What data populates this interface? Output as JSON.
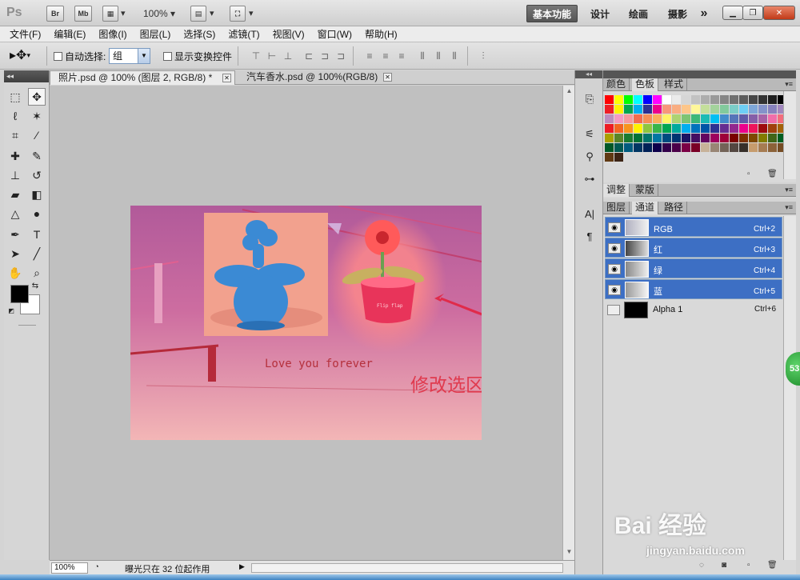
{
  "titlebar": {
    "app_logo": "Ps",
    "bridge": "Br",
    "minibridge": "Mb",
    "zoom": "100%",
    "workspaces": [
      "基本功能",
      "设计",
      "绘画",
      "摄影"
    ],
    "more": "»"
  },
  "menu": [
    "文件(F)",
    "编辑(E)",
    "图像(I)",
    "图层(L)",
    "选择(S)",
    "滤镜(T)",
    "视图(V)",
    "窗口(W)",
    "帮助(H)"
  ],
  "options": {
    "auto_select_label": "自动选择:",
    "auto_select_value": "组",
    "show_transform_label": "显示变换控件"
  },
  "doc_tabs": [
    {
      "label": "照片.psd @ 100% (图层 2, RGB/8) *",
      "active": true
    },
    {
      "label": "汽车香水.psd @ 100%(RGB/8)",
      "active": false
    }
  ],
  "canvas": {
    "caption": "Love you forever",
    "annotation": "修改选区",
    "pot_text": "Flip flap"
  },
  "status": {
    "zoom": "100%",
    "message": "曝光只在 32 位起作用"
  },
  "swatch_panel": {
    "tabs": [
      "颜色",
      "色板",
      "样式"
    ],
    "active": 1,
    "colors": [
      "#ff0000",
      "#ffff00",
      "#00ff00",
      "#00ffff",
      "#0000ff",
      "#ff00ff",
      "#ffffff",
      "#ebebeb",
      "#d6d6d6",
      "#c2c2c2",
      "#adadad",
      "#999999",
      "#858585",
      "#707070",
      "#5c5c5c",
      "#474747",
      "#333333",
      "#1f1f1f",
      "#000000",
      "#ee1d24",
      "#fef200",
      "#00a650",
      "#00aeef",
      "#2e3092",
      "#ec008c",
      "#f7977a",
      "#f9ad81",
      "#fdc68a",
      "#fff79a",
      "#c4df9b",
      "#a3d39c",
      "#82ca9d",
      "#7bcdc8",
      "#6ecff6",
      "#7ea7d8",
      "#8493ca",
      "#8882be",
      "#a187be",
      "#bc8dbf",
      "#f49ac2",
      "#f6989d",
      "#f26c4f",
      "#f68e55",
      "#fbaf5c",
      "#fff467",
      "#acd372",
      "#7dc473",
      "#3cb878",
      "#1cbbb4",
      "#00bff3",
      "#438ccb",
      "#5574b9",
      "#605ca8",
      "#855fa8",
      "#a763a8",
      "#f06eaa",
      "#f26d7d",
      "#ed1c24",
      "#f26522",
      "#f7941d",
      "#fff200",
      "#8dc63f",
      "#39b54a",
      "#00a651",
      "#00a99d",
      "#00aeef",
      "#0072bc",
      "#0054a6",
      "#2e3192",
      "#662d91",
      "#92278f",
      "#ec008c",
      "#ed145b",
      "#9e0b0f",
      "#a0410d",
      "#a36209",
      "#aba000",
      "#598527",
      "#197b30",
      "#007236",
      "#00746b",
      "#0076a3",
      "#004b80",
      "#003471",
      "#1b1464",
      "#440e62",
      "#630460",
      "#9e005d",
      "#9e0039",
      "#790000",
      "#7b2e00",
      "#7d4900",
      "#827b00",
      "#406618",
      "#005e20",
      "#005826",
      "#005952",
      "#005b7f",
      "#003663",
      "#002157",
      "#0d004c",
      "#32004b",
      "#4b0049",
      "#7b0046",
      "#7a0026",
      "#c7b299",
      "#998675",
      "#736357",
      "#534741",
      "#372f2a",
      "#c69c6d",
      "#a67c52",
      "#8c6239",
      "#754c24",
      "#603913",
      "#3c2415"
    ]
  },
  "adjust_panel": {
    "tabs": [
      "调整",
      "蒙版"
    ],
    "active": 0
  },
  "channels_panel": {
    "tabs": [
      "图层",
      "通道",
      "路径"
    ],
    "active": 1,
    "rows": [
      {
        "name": "RGB",
        "shortcut": "Ctrl+2",
        "selected": true
      },
      {
        "name": "红",
        "shortcut": "Ctrl+3",
        "selected": true
      },
      {
        "name": "绿",
        "shortcut": "Ctrl+4",
        "selected": true
      },
      {
        "name": "蓝",
        "shortcut": "Ctrl+5",
        "selected": true
      },
      {
        "name": "Alpha 1",
        "shortcut": "Ctrl+6",
        "selected": false
      }
    ]
  },
  "badge": "53",
  "watermark": {
    "brand": "Bai 经验",
    "url": "jingyan.baidu.com"
  }
}
